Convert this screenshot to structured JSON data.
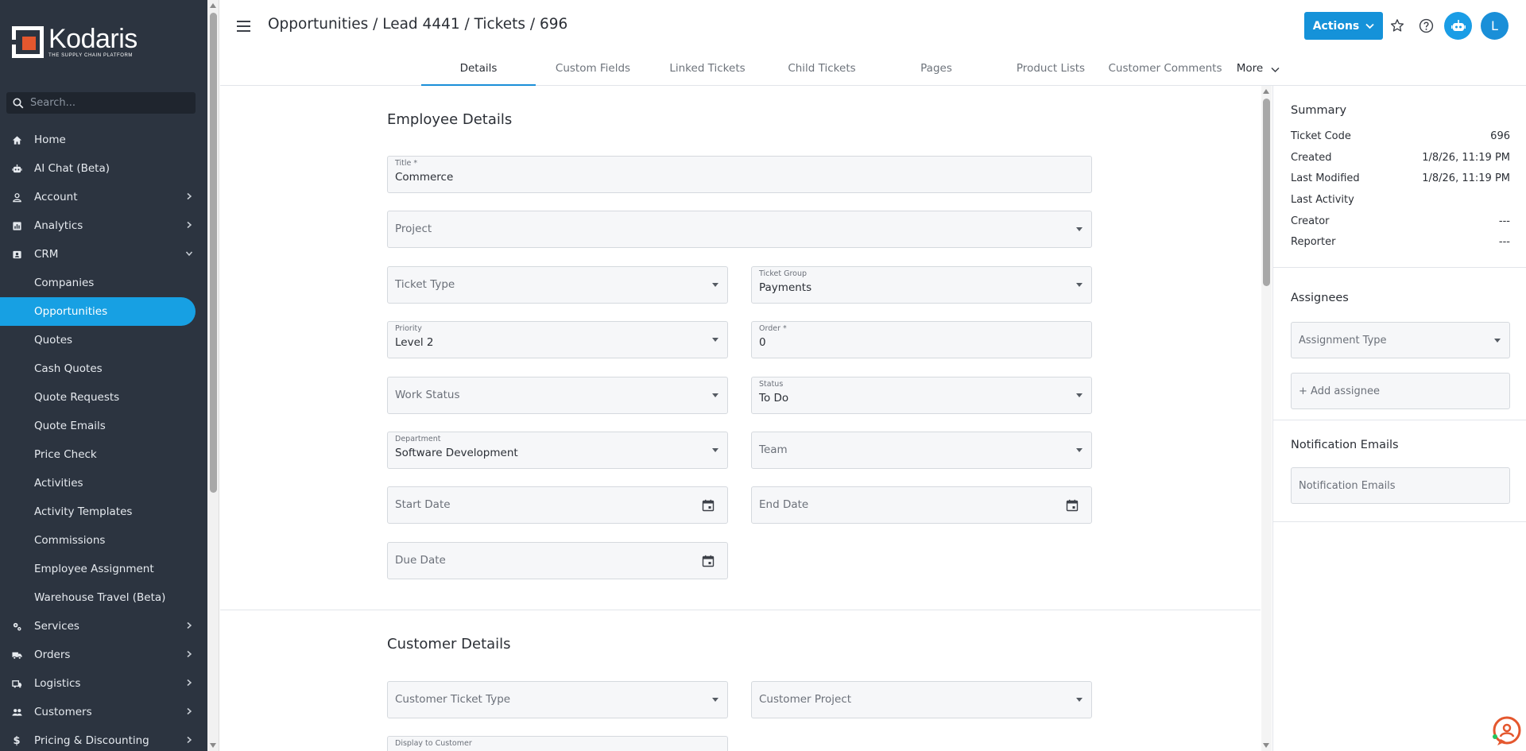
{
  "brand": {
    "name": "Kodaris",
    "tagline": "THE SUPPLY CHAIN PLATFORM"
  },
  "search": {
    "placeholder": "Search..."
  },
  "sidebar": {
    "items": [
      {
        "label": "Home",
        "icon": "home-icon"
      },
      {
        "label": "AI Chat (Beta)",
        "icon": "robot-icon"
      },
      {
        "label": "Account",
        "icon": "person-icon"
      },
      {
        "label": "Analytics",
        "icon": "analytics-icon"
      },
      {
        "label": "CRM",
        "icon": "crm-icon"
      },
      {
        "label": "Companies"
      },
      {
        "label": "Opportunities"
      },
      {
        "label": "Quotes"
      },
      {
        "label": "Cash Quotes"
      },
      {
        "label": "Quote Requests"
      },
      {
        "label": "Quote Emails"
      },
      {
        "label": "Price Check"
      },
      {
        "label": "Activities"
      },
      {
        "label": "Activity Templates"
      },
      {
        "label": "Commissions"
      },
      {
        "label": "Employee Assignment"
      },
      {
        "label": "Warehouse Travel (Beta)"
      },
      {
        "label": "Services",
        "icon": "services-icon"
      },
      {
        "label": "Orders",
        "icon": "truck-icon"
      },
      {
        "label": "Logistics",
        "icon": "logistics-icon"
      },
      {
        "label": "Customers",
        "icon": "people-icon"
      },
      {
        "label": "Pricing & Discounting",
        "icon": "dollar-icon"
      }
    ]
  },
  "header": {
    "breadcrumb": "Opportunities / Lead 4441 / Tickets / 696",
    "actions_label": "Actions",
    "avatar_initial": "L"
  },
  "tabs": [
    {
      "label": "Details"
    },
    {
      "label": "Custom Fields"
    },
    {
      "label": "Linked Tickets"
    },
    {
      "label": "Child Tickets"
    },
    {
      "label": "Pages"
    },
    {
      "label": "Product Lists"
    },
    {
      "label": "Customer Comments"
    },
    {
      "label": "More"
    }
  ],
  "employee_details": {
    "title": "Employee Details",
    "fields": {
      "title": {
        "label": "Title *",
        "value": "Commerce"
      },
      "project": {
        "placeholder": "Project"
      },
      "ticket_type": {
        "placeholder": "Ticket Type"
      },
      "ticket_group": {
        "label": "Ticket Group",
        "value": "Payments"
      },
      "priority": {
        "label": "Priority",
        "value": "Level 2"
      },
      "order": {
        "label": "Order *",
        "value": "0"
      },
      "work_status": {
        "placeholder": "Work Status"
      },
      "status": {
        "label": "Status",
        "value": "To Do"
      },
      "department": {
        "label": "Department",
        "value": "Software Development"
      },
      "team": {
        "placeholder": "Team"
      },
      "start_date": {
        "placeholder": "Start Date"
      },
      "end_date": {
        "placeholder": "End Date"
      },
      "due_date": {
        "placeholder": "Due Date"
      }
    }
  },
  "customer_details": {
    "title": "Customer Details",
    "fields": {
      "customer_ticket_type": {
        "placeholder": "Customer Ticket Type"
      },
      "customer_project": {
        "placeholder": "Customer Project"
      },
      "display_to_customer": {
        "label": "Display to Customer"
      }
    }
  },
  "summary": {
    "title": "Summary",
    "rows": [
      {
        "label": "Ticket Code",
        "value": "696"
      },
      {
        "label": "Created",
        "value": "1/8/26, 11:19 PM"
      },
      {
        "label": "Last Modified",
        "value": "1/8/26, 11:19 PM"
      },
      {
        "label": "Last Activity",
        "value": ""
      },
      {
        "label": "Creator",
        "value": "---"
      },
      {
        "label": "Reporter",
        "value": "---"
      }
    ]
  },
  "assignees": {
    "title": "Assignees",
    "assignment_type_placeholder": "Assignment Type",
    "add_assignee_label": "+ Add assignee"
  },
  "notification_emails": {
    "title": "Notification Emails",
    "placeholder": "Notification Emails"
  },
  "colors": {
    "sidebar_bg": "#2c3440",
    "accent": "#17a0e3",
    "brand_orange": "#e4572e"
  }
}
